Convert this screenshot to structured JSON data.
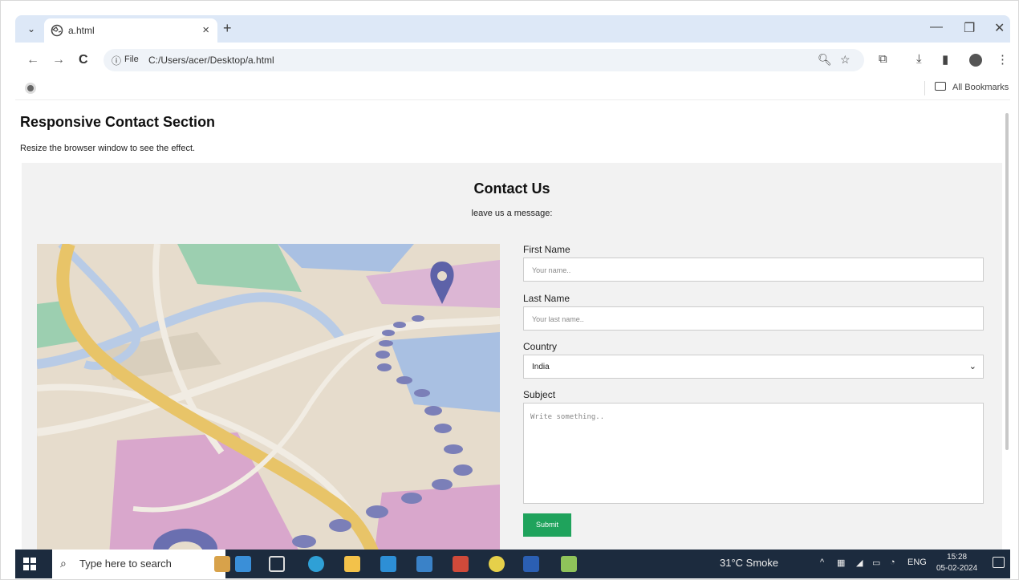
{
  "browser": {
    "tab_title": "a.html",
    "tab_close": "×",
    "new_tab": "+",
    "url_info": "ⓘ",
    "url_scheme_label": "File",
    "url": "C:/Users/acer/Desktop/a.html",
    "bookmarks_label": "All Bookmarks",
    "window_controls": {
      "minimize": "—",
      "restore": "❐",
      "close": "✕"
    }
  },
  "page": {
    "title": "Responsive Contact Section",
    "subtitle": "Resize the browser window to see the effect."
  },
  "contact": {
    "heading": "Contact Us",
    "subheading": "leave us a message:",
    "first_name_label": "First Name",
    "first_name_placeholder": "Your name..",
    "last_name_label": "Last Name",
    "last_name_placeholder": "Your last name..",
    "country_label": "Country",
    "country_value": "India",
    "subject_label": "Subject",
    "subject_placeholder": "Write something..",
    "submit_label": "Submit"
  },
  "taskbar": {
    "search_placeholder": "Type here to search",
    "weather": "31°C  Smoke",
    "language": "ENG",
    "time": "15:28",
    "date": "05-02-2024"
  },
  "colors": {
    "submit": "#1fa35c",
    "taskbar": "#1c2b3e",
    "tab_strip": "#dde8f7"
  }
}
